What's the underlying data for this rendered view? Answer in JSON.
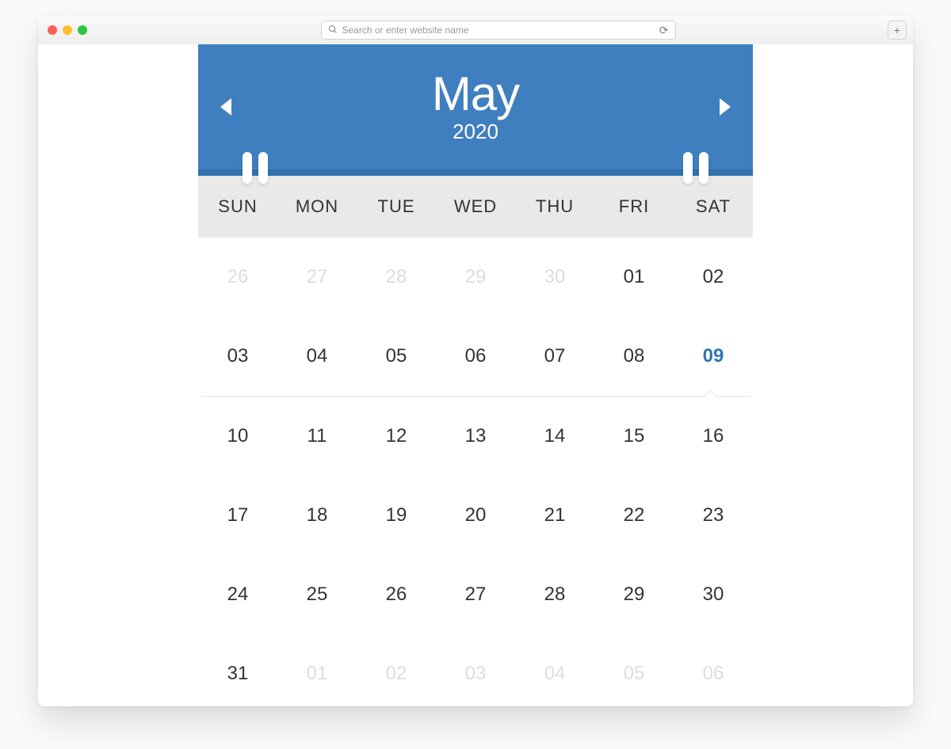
{
  "browser": {
    "search_placeholder": "Search or enter website name"
  },
  "calendar": {
    "month": "May",
    "year": "2020",
    "day_names": [
      "SUN",
      "MON",
      "TUE",
      "WED",
      "THU",
      "FRI",
      "SAT"
    ],
    "weeks": [
      [
        {
          "d": "26",
          "outside": true
        },
        {
          "d": "27",
          "outside": true
        },
        {
          "d": "28",
          "outside": true
        },
        {
          "d": "29",
          "outside": true
        },
        {
          "d": "30",
          "outside": true
        },
        {
          "d": "01",
          "outside": false
        },
        {
          "d": "02",
          "outside": false
        }
      ],
      [
        {
          "d": "03"
        },
        {
          "d": "04"
        },
        {
          "d": "05"
        },
        {
          "d": "06"
        },
        {
          "d": "07"
        },
        {
          "d": "08"
        },
        {
          "d": "09",
          "selected": true
        }
      ],
      [
        {
          "d": "10"
        },
        {
          "d": "11"
        },
        {
          "d": "12"
        },
        {
          "d": "13"
        },
        {
          "d": "14"
        },
        {
          "d": "15"
        },
        {
          "d": "16"
        }
      ],
      [
        {
          "d": "17"
        },
        {
          "d": "18"
        },
        {
          "d": "19"
        },
        {
          "d": "20"
        },
        {
          "d": "21"
        },
        {
          "d": "22"
        },
        {
          "d": "23"
        }
      ],
      [
        {
          "d": "24"
        },
        {
          "d": "25"
        },
        {
          "d": "26"
        },
        {
          "d": "27"
        },
        {
          "d": "28"
        },
        {
          "d": "29"
        },
        {
          "d": "30"
        }
      ],
      [
        {
          "d": "31"
        },
        {
          "d": "01",
          "outside": true
        },
        {
          "d": "02",
          "outside": true
        },
        {
          "d": "03",
          "outside": true
        },
        {
          "d": "04",
          "outside": true
        },
        {
          "d": "05",
          "outside": true
        },
        {
          "d": "06",
          "outside": true
        }
      ]
    ],
    "colors": {
      "header": "#3f7fbf",
      "header_dark": "#3172ac",
      "selected": "#2f74b5"
    }
  }
}
